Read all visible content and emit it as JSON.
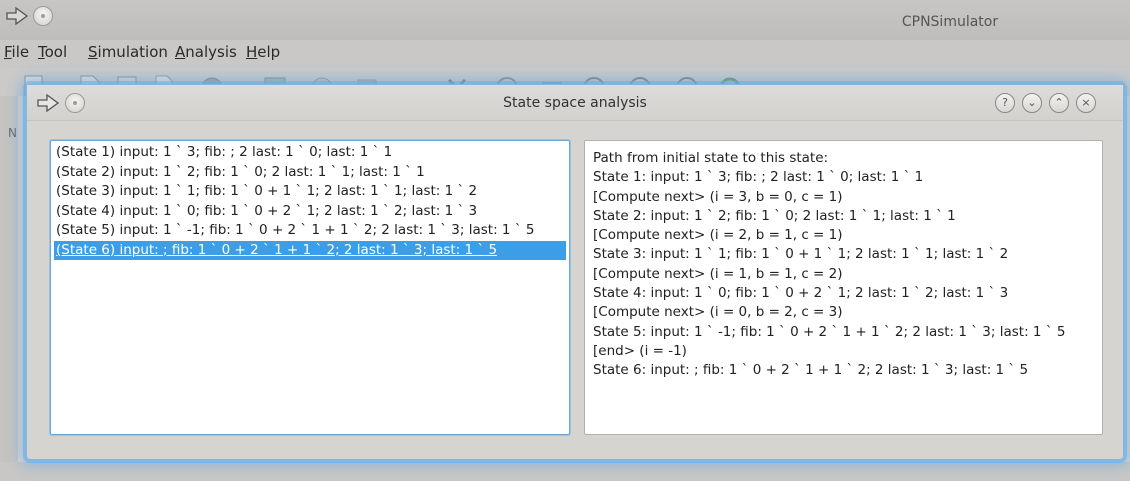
{
  "main_window": {
    "title": "CPNSimulator",
    "menu": [
      {
        "pre": "",
        "accel": "F",
        "post": "ile"
      },
      {
        "pre": "",
        "accel": "T",
        "post": "ool"
      },
      {
        "pre": "",
        "accel": "S",
        "post": "imulation"
      },
      {
        "pre": "",
        "accel": "A",
        "post": "nalysis"
      },
      {
        "pre": "",
        "accel": "H",
        "post": "elp"
      }
    ],
    "side_hint": "N"
  },
  "dialog": {
    "title": "State space analysis",
    "buttons": {
      "help": "?",
      "minimize": "⌄",
      "maximize": "⌃",
      "close": "×"
    },
    "states": [
      "(State 1) input: 1 ` 3; fib: ; 2 last: 1 ` 0; last: 1 ` 1",
      "(State 2) input: 1 ` 2; fib: 1 ` 0; 2 last: 1 ` 1; last: 1 ` 1",
      "(State 3) input: 1 ` 1; fib: 1 ` 0 + 1 ` 1; 2 last: 1 ` 1; last: 1 ` 2",
      "(State 4) input: 1 ` 0; fib: 1 ` 0 + 2 ` 1; 2 last: 1 ` 2; last: 1 ` 3",
      "(State 5) input: 1 ` -1; fib: 1 ` 0 + 2 ` 1 + 1 ` 2; 2 last: 1 ` 3; last: 1 ` 5",
      "(State 6) input: ; fib: 1 ` 0 + 2 ` 1 + 1 ` 2; 2 last: 1 ` 3; last: 1 ` 5"
    ],
    "selected_index": 5,
    "path_lines": [
      "Path from initial state to this state:",
      "State 1: input: 1 ` 3; fib: ; 2 last: 1 ` 0; last: 1 ` 1",
      "[Compute next> (i = 3, b = 0, c = 1)",
      "State 2: input: 1 ` 2; fib: 1 ` 0; 2 last: 1 ` 1; last: 1 ` 1",
      "[Compute next> (i = 2, b = 1, c = 1)",
      "State 3: input: 1 ` 1; fib: 1 ` 0 + 1 ` 1; 2 last: 1 ` 1; last: 1 ` 2",
      "[Compute next> (i = 1, b = 1, c = 2)",
      "State 4: input: 1 ` 0; fib: 1 ` 0 + 2 ` 1; 2 last: 1 ` 2; last: 1 ` 3",
      "[Compute next> (i = 0, b = 2, c = 3)",
      "State 5: input: 1 ` -1; fib: 1 ` 0 + 2 ` 1 + 1 ` 2; 2 last: 1 ` 3; last: 1 ` 5",
      "[end> (i = -1)",
      "State 6: input: ; fib: 1 ` 0 + 2 ` 1 + 1 ` 2; 2 last: 1 ` 3; last: 1 ` 5"
    ]
  },
  "colors": {
    "selection": "#3d9ee8",
    "focus_glow": "#64afeb"
  }
}
